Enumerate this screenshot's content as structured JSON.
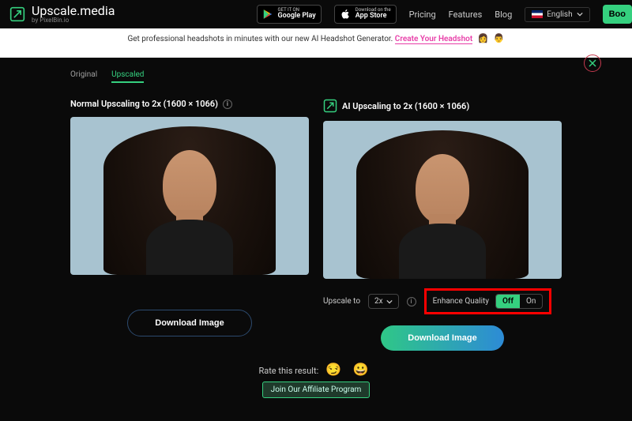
{
  "header": {
    "brand_name": "Upscale.media",
    "brand_sub": "by PixelBin.io",
    "google_play_line1": "GET IT ON",
    "google_play_line2": "Google Play",
    "app_store_line1": "Download on the",
    "app_store_line2": "App Store",
    "nav": {
      "pricing": "Pricing",
      "features": "Features",
      "blog": "Blog"
    },
    "language": "English",
    "boost": "Boo"
  },
  "promo": {
    "text": "Get professional headshots in minutes with our new AI Headshot Generator. ",
    "cta": "Create Your Headshot"
  },
  "tabs": {
    "original": "Original",
    "upscaled": "Upscaled"
  },
  "left": {
    "title": "Normal Upscaling to 2x (1600 × 1066)",
    "download": "Download Image"
  },
  "right": {
    "title": "AI Upscaling to 2x (1600 × 1066)",
    "upscale_label": "Upscale to",
    "upscale_value": "2x",
    "enhance_label": "Enhance Quality",
    "off": "Off",
    "on": "On",
    "download": "Download Image"
  },
  "rate": {
    "label": "Rate this result:",
    "affiliate": "Join Our Affiliate Program"
  }
}
